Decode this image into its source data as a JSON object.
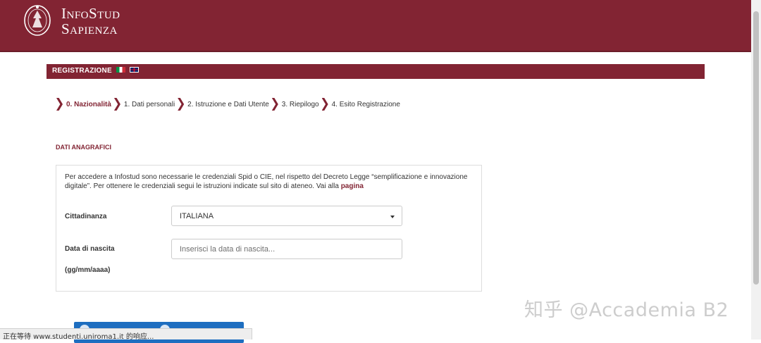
{
  "header": {
    "brand_line1": "InfoStud",
    "brand_line2": "Sapienza",
    "logo_icon": "sapienza-seal-icon",
    "color": "#822433"
  },
  "registration": {
    "bar_label": "REGISTRAZIONE",
    "flags": [
      "flag-italy-icon",
      "flag-uk-icon"
    ]
  },
  "steps": [
    {
      "label": "0. Nazionalità",
      "active": true
    },
    {
      "label": "1. Dati personali",
      "active": false
    },
    {
      "label": "2. Istruzione e Dati Utente",
      "active": false
    },
    {
      "label": "3. Riepilogo",
      "active": false
    },
    {
      "label": "4. Esito Registrazione",
      "active": false
    }
  ],
  "section": {
    "title": "DATI ANAGRAFICI",
    "intro_text": "Per accedere a Infostud sono necessarie le credenziali Spid o CIE, nel rispetto del Decreto Legge “semplificazione e innovazione digitale”. Per ottenere le credenziali segui le istruzioni indicate sul sito di ateneo. Vai alla ",
    "intro_link": "pagina"
  },
  "form": {
    "cittadinanza_label": "Cittadinanza",
    "cittadinanza_value": "ITALIANA",
    "nascita_label": "Data di nascita",
    "nascita_placeholder": "Inserisci la data di nascita...",
    "nascita_format": "(gg/mm/aaaa)"
  },
  "status_bar": {
    "text": "正在等待 www.studenti.uniroma1.it 的响应..."
  },
  "watermark": {
    "text": "知乎 @Accademia B2"
  }
}
